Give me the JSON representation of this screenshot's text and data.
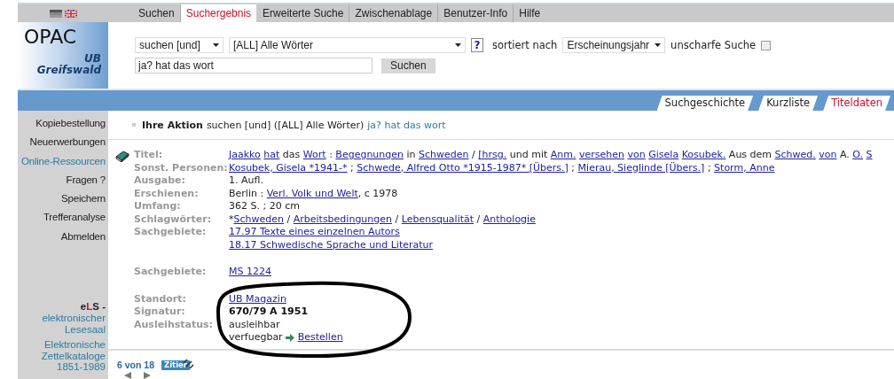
{
  "top_nav": {
    "tabs": [
      {
        "label": "Suchen",
        "selected": false
      },
      {
        "label": "Suchergebnis",
        "selected": true
      },
      {
        "label": "Erweiterte Suche",
        "selected": false
      },
      {
        "label": "Zwischenablage",
        "selected": false
      },
      {
        "label": "Benutzer-Info",
        "selected": false
      },
      {
        "label": "Hilfe",
        "selected": false
      }
    ]
  },
  "logo": {
    "title": "OPAC",
    "line_1": "UB",
    "line_2": "Greifswald"
  },
  "search_form": {
    "operator": "suchen [und]",
    "index": "[ALL] Alle Wörter",
    "help": "?",
    "sort_label": "sortiert nach",
    "sort": "Erscheinungsjahr",
    "fuzzy_label": "unscharfe Suche",
    "fuzzy_checked": false,
    "query": "ja? hat das wort",
    "submit": "Suchen"
  },
  "view_tabs": [
    {
      "label": "Suchgeschichte",
      "selected": false
    },
    {
      "label": "Kurzliste",
      "selected": false
    },
    {
      "label": "Titeldaten",
      "selected": true
    }
  ],
  "sidebar": {
    "items": [
      {
        "label": "Kopiebestellung",
        "kind": "plain"
      },
      {
        "label": "Neuerwerbungen",
        "kind": "plain"
      },
      {
        "label": "Online-Ressourcen",
        "kind": "external"
      },
      {
        "label": "Fragen ?",
        "kind": "plain"
      },
      {
        "label": "Speichern",
        "kind": "plain"
      },
      {
        "label": "Trefferanalyse",
        "kind": "plain"
      },
      {
        "label": "Abmelden",
        "kind": "plain"
      }
    ],
    "els": {
      "prefix": "e",
      "accent": "L",
      "suffix": "S -",
      "link": "elektronischer Lesesaal"
    },
    "catalogues_link": "Elektronische Zettelkataloge 1851-1989"
  },
  "action": {
    "label": "Ihre Aktion",
    "text": "suchen [und] ([ALL] Alle Wörter)",
    "query": "ja? hat das wort"
  },
  "record": {
    "groups": [
      [
        {
          "label": "Titel:",
          "lines": [
            [
              {
                "kind": "link",
                "text": "Jaakko"
              },
              {
                "kind": "link",
                "text": "hat"
              },
              {
                "kind": "text",
                "text": "das"
              },
              {
                "kind": "link",
                "text": "Wort"
              },
              {
                "kind": "text",
                "text": ":"
              },
              {
                "kind": "link",
                "text": "Begegnungen"
              },
              {
                "kind": "text",
                "text": "in"
              },
              {
                "kind": "link",
                "text": "Schweden"
              },
              {
                "kind": "text",
                "text": "/"
              },
              {
                "kind": "link",
                "text": "[hrsg."
              },
              {
                "kind": "text",
                "text": "und mit"
              },
              {
                "kind": "link",
                "text": "Anm."
              },
              {
                "kind": "link",
                "text": "versehen"
              },
              {
                "kind": "link",
                "text": "von"
              },
              {
                "kind": "link",
                "text": "Gisela"
              },
              {
                "kind": "link",
                "text": "Kosubek."
              },
              {
                "kind": "text",
                "text": "Aus dem"
              },
              {
                "kind": "link",
                "text": "Schwed."
              },
              {
                "kind": "link",
                "text": "von"
              },
              {
                "kind": "text",
                "text": "A."
              },
              {
                "kind": "link",
                "text": "O."
              },
              {
                "kind": "link",
                "text": "S"
              }
            ]
          ]
        },
        {
          "label": "Sonst. Personen:",
          "lines": [
            [
              {
                "kind": "link",
                "text": "Kosubek, Gisela *1941-*"
              },
              {
                "kind": "text",
                "text": ";"
              },
              {
                "kind": "link",
                "text": "Schwede, Alfred Otto *1915-1987* [Übers.]"
              },
              {
                "kind": "text",
                "text": ";"
              },
              {
                "kind": "link",
                "text": "Mierau, Sieglinde [Übers.]"
              },
              {
                "kind": "text",
                "text": ";"
              },
              {
                "kind": "link",
                "text": "Storm, Anne"
              }
            ]
          ]
        },
        {
          "label": "Ausgabe:",
          "lines": [
            [
              {
                "kind": "text",
                "text": "1. Aufl."
              }
            ]
          ]
        },
        {
          "label": "Erschienen:",
          "lines": [
            [
              {
                "kind": "text",
                "text": "Berlin :"
              },
              {
                "kind": "link",
                "text": "Verl. Volk und Welt"
              },
              {
                "kind": "text",
                "text": ", c 1978",
                "glue": true
              }
            ]
          ]
        },
        {
          "label": "Umfang:",
          "lines": [
            [
              {
                "kind": "text",
                "text": "362 S. ; 20 cm"
              }
            ]
          ]
        },
        {
          "label": "Schlagwörter:",
          "lines": [
            [
              {
                "kind": "text",
                "text": "*"
              },
              {
                "kind": "link",
                "text": "Schweden",
                "glue": true
              },
              {
                "kind": "text",
                "text": "/"
              },
              {
                "kind": "link",
                "text": "Arbeitsbedingungen"
              },
              {
                "kind": "text",
                "text": "/"
              },
              {
                "kind": "link",
                "text": "Lebensqualität"
              },
              {
                "kind": "text",
                "text": "/"
              },
              {
                "kind": "link",
                "text": "Anthologie"
              }
            ]
          ]
        },
        {
          "label": "Sachgebiete:",
          "lines": [
            [
              {
                "kind": "link",
                "text": "17.97 Texte eines einzelnen Autors"
              }
            ],
            [
              {
                "kind": "link",
                "text": "18.17 Schwedische Sprache und Literatur"
              }
            ]
          ]
        }
      ],
      [
        {
          "label": "Sachgebiete:",
          "lines": [
            [
              {
                "kind": "link",
                "text": "MS 1224"
              }
            ]
          ]
        }
      ],
      [
        {
          "label": "Standort:",
          "lines": [
            [
              {
                "kind": "link",
                "text": "UB Magazin"
              }
            ]
          ]
        },
        {
          "label": "Signatur:",
          "lines": [
            [
              {
                "kind": "bold",
                "text": "670/79 A 1951"
              }
            ]
          ]
        },
        {
          "label": "Ausleihstatus:",
          "lines": [
            [
              {
                "kind": "text",
                "text": "ausleihbar"
              }
            ],
            [
              {
                "kind": "text",
                "text": "verfuegbar"
              },
              {
                "kind": "arrow"
              },
              {
                "kind": "link",
                "text": "Bestellen"
              }
            ]
          ]
        }
      ]
    ]
  },
  "pager": {
    "position": "6 von 18",
    "cite": "Zitier"
  }
}
